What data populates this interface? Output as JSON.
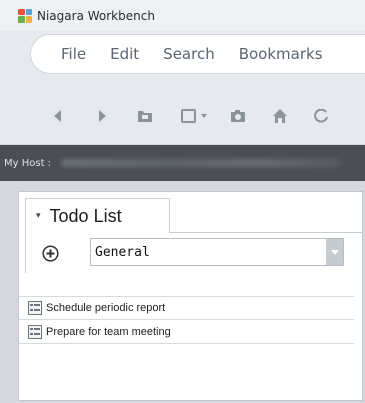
{
  "window": {
    "title": "Niagara Workbench"
  },
  "menu": {
    "items": [
      "File",
      "Edit",
      "Search",
      "Bookmarks"
    ]
  },
  "toolbar": {
    "buttons": [
      "back-icon",
      "forward-icon",
      "folder-icon",
      "view-menu-icon",
      "camera-icon",
      "home-icon",
      "refresh-icon"
    ]
  },
  "locator": {
    "host_label": "My Host :"
  },
  "todo": {
    "tab_title": "Todo List",
    "group_value": "General",
    "tasks": [
      {
        "label": "Schedule periodic report"
      },
      {
        "label": "Prepare for team meeting"
      }
    ]
  },
  "colors": {
    "locator_bg": "#4b4f55",
    "panel_bg": "#ffffff",
    "icon_gray": "#8a929b"
  }
}
